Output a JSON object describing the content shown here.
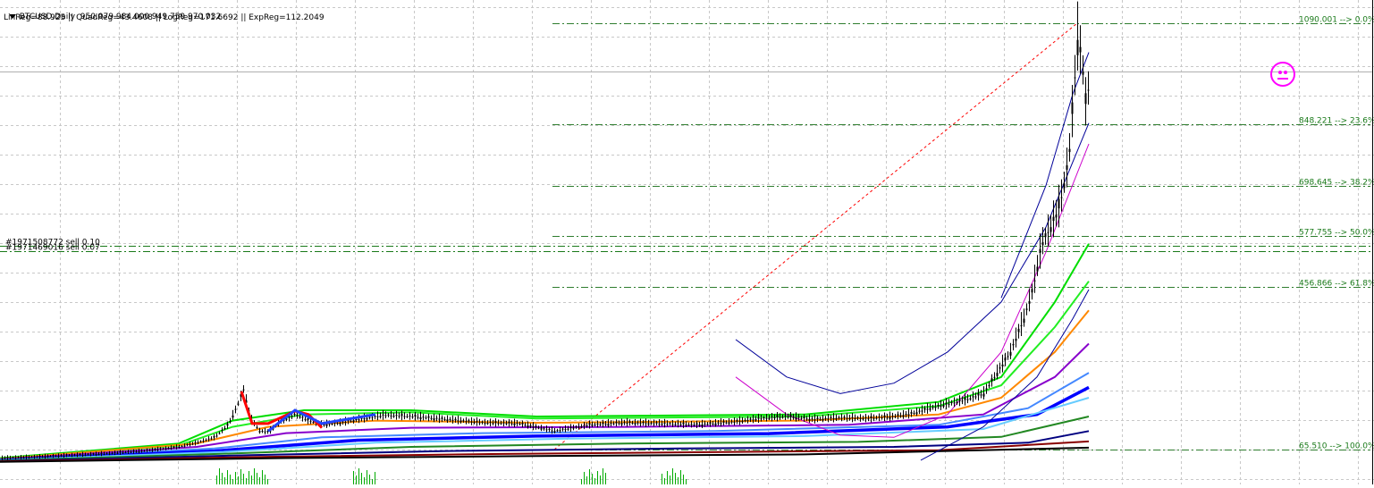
{
  "header": {
    "symbol": "BTCUSD,Daily",
    "ohlc": "950.079 984.000 949.759 970.032",
    "regressions": "LinReg=88.925 || QuadReg=43.4608 || LogReg=171.6692 || ExpReg=112.2049"
  },
  "orders": [
    {
      "label": "#1971508772 sell 0.10",
      "price": 556
    },
    {
      "label": "#1971469016 sell 0.07",
      "price": 543
    }
  ],
  "chart_data": {
    "type": "line",
    "title": "",
    "xlabel": "",
    "ylabel": "",
    "ylim": [
      40,
      1120
    ],
    "grid": true,
    "fib_levels": [
      {
        "label": "1090.001 --> 0.0%",
        "price": 1090.0
      },
      {
        "label": "848.221 --> 23.6%",
        "price": 848.2
      },
      {
        "label": "698.645 --> 38.2%",
        "price": 698.6
      },
      {
        "label": "577.755 --> 50.0%",
        "price": 577.8
      },
      {
        "label": "456.866 --> 61.8%",
        "price": 456.9
      },
      {
        "label": "65.510 --> 100.0%",
        "price": 65.5
      }
    ],
    "price_series": {
      "name": "",
      "x": [
        0,
        40,
        80,
        120,
        160,
        200,
        220,
        240,
        255,
        265,
        272,
        280,
        290,
        300,
        315,
        330,
        345,
        360,
        380,
        400,
        430,
        460,
        500,
        540,
        580,
        620,
        660,
        700,
        740,
        780,
        820,
        850,
        880,
        910,
        940,
        970,
        1000,
        1020,
        1040,
        1060,
        1080,
        1100,
        1115,
        1130,
        1145,
        1155,
        1165,
        1175,
        1185,
        1195,
        1200,
        1205,
        1210,
        1215,
        1218
      ],
      "values": [
        45,
        48,
        52,
        56,
        62,
        72,
        82,
        95,
        125,
        170,
        210,
        140,
        110,
        108,
        135,
        150,
        135,
        125,
        130,
        138,
        148,
        145,
        138,
        130,
        128,
        110,
        125,
        130,
        128,
        125,
        132,
        140,
        145,
        138,
        142,
        140,
        145,
        152,
        165,
        175,
        185,
        200,
        250,
        300,
        380,
        450,
        560,
        600,
        650,
        760,
        900,
        1050,
        1000,
        870,
        960
      ]
    },
    "fib_line": {
      "from": [
        620,
        65.5
      ],
      "to": [
        1205,
        1090
      ]
    },
    "ma_series": [
      {
        "name": "",
        "color": "#00dd00",
        "values": [
          [
            0,
            45
          ],
          [
            200,
            80
          ],
          [
            260,
            135
          ],
          [
            340,
            160
          ],
          [
            460,
            160
          ],
          [
            600,
            145
          ],
          [
            900,
            150
          ],
          [
            1050,
            180
          ],
          [
            1120,
            240
          ],
          [
            1180,
            420
          ],
          [
            1218,
            560
          ]
        ]
      },
      {
        "name": "",
        "color": "#22ee22",
        "values": [
          [
            0,
            44
          ],
          [
            200,
            75
          ],
          [
            260,
            120
          ],
          [
            340,
            150
          ],
          [
            460,
            155
          ],
          [
            600,
            140
          ],
          [
            900,
            145
          ],
          [
            1050,
            170
          ],
          [
            1120,
            220
          ],
          [
            1180,
            360
          ],
          [
            1218,
            470
          ]
        ]
      },
      {
        "name": "",
        "color": "#ff8800",
        "values": [
          [
            0,
            43
          ],
          [
            220,
            80
          ],
          [
            300,
            120
          ],
          [
            420,
            135
          ],
          [
            600,
            130
          ],
          [
            900,
            135
          ],
          [
            1050,
            150
          ],
          [
            1120,
            190
          ],
          [
            1180,
            300
          ],
          [
            1218,
            400
          ]
        ]
      },
      {
        "name": "",
        "color": "#8800cc",
        "values": [
          [
            0,
            42
          ],
          [
            220,
            72
          ],
          [
            320,
            105
          ],
          [
            460,
            118
          ],
          [
            700,
            120
          ],
          [
            950,
            125
          ],
          [
            1100,
            150
          ],
          [
            1180,
            240
          ],
          [
            1218,
            320
          ]
        ]
      },
      {
        "name": "",
        "color": "#4488ff",
        "values": [
          [
            0,
            41
          ],
          [
            240,
            68
          ],
          [
            360,
            95
          ],
          [
            540,
            105
          ],
          [
            800,
            110
          ],
          [
            1050,
            125
          ],
          [
            1150,
            165
          ],
          [
            1218,
            250
          ]
        ]
      },
      {
        "name": "",
        "color": "#0000ff",
        "width": 3.5,
        "values": [
          [
            0,
            40
          ],
          [
            240,
            62
          ],
          [
            400,
            88
          ],
          [
            600,
            98
          ],
          [
            860,
            104
          ],
          [
            1060,
            120
          ],
          [
            1160,
            150
          ],
          [
            1218,
            215
          ]
        ]
      },
      {
        "name": "",
        "color": "#66ccff",
        "values": [
          [
            0,
            40
          ],
          [
            250,
            60
          ],
          [
            420,
            82
          ],
          [
            640,
            92
          ],
          [
            900,
            98
          ],
          [
            1100,
            115
          ],
          [
            1218,
            190
          ]
        ]
      },
      {
        "name": "",
        "color": "#228822",
        "values": [
          [
            0,
            39
          ],
          [
            260,
            56
          ],
          [
            460,
            72
          ],
          [
            700,
            80
          ],
          [
            960,
            84
          ],
          [
            1120,
            96
          ],
          [
            1218,
            145
          ]
        ]
      },
      {
        "name": "",
        "color": "#000080",
        "values": [
          [
            0,
            38
          ],
          [
            280,
            52
          ],
          [
            500,
            62
          ],
          [
            760,
            68
          ],
          [
            1000,
            72
          ],
          [
            1150,
            82
          ],
          [
            1218,
            110
          ]
        ]
      },
      {
        "name": "",
        "color": "#880000",
        "values": [
          [
            0,
            37
          ],
          [
            300,
            48
          ],
          [
            560,
            55
          ],
          [
            820,
            60
          ],
          [
            1050,
            64
          ],
          [
            1218,
            85
          ]
        ]
      },
      {
        "name": "",
        "color": "#000000",
        "values": [
          [
            0,
            36
          ],
          [
            320,
            45
          ],
          [
            600,
            50
          ],
          [
            900,
            54
          ],
          [
            1218,
            70
          ]
        ]
      }
    ],
    "zigzag_red": [
      [
        270,
        205
      ],
      [
        282,
        128
      ],
      [
        300,
        128
      ],
      [
        330,
        158
      ],
      [
        345,
        150
      ],
      [
        360,
        118
      ]
    ],
    "zigzag_blue": [
      [
        300,
        110
      ],
      [
        315,
        135
      ],
      [
        330,
        160
      ],
      [
        360,
        128
      ],
      [
        420,
        150
      ]
    ],
    "regression_curves": [
      {
        "name": "",
        "color": "#000099",
        "values": [
          [
            823,
            330
          ],
          [
            880,
            240
          ],
          [
            940,
            200
          ],
          [
            1000,
            225
          ],
          [
            1060,
            300
          ],
          [
            1120,
            420
          ],
          [
            1170,
            600
          ],
          [
            1218,
            850
          ]
        ]
      },
      {
        "name": "",
        "color": "#000099",
        "values": [
          [
            1030,
            40
          ],
          [
            1100,
            120
          ],
          [
            1160,
            240
          ],
          [
            1200,
            380
          ],
          [
            1218,
            450
          ]
        ]
      },
      {
        "name": "",
        "color": "#000099",
        "values": [
          [
            1120,
            430
          ],
          [
            1170,
            700
          ],
          [
            1200,
            920
          ],
          [
            1218,
            1020
          ]
        ]
      },
      {
        "name": "",
        "color": "#cc00cc",
        "values": [
          [
            823,
            240
          ],
          [
            880,
            150
          ],
          [
            940,
            100
          ],
          [
            1000,
            95
          ],
          [
            1060,
            150
          ],
          [
            1120,
            300
          ],
          [
            1170,
            540
          ],
          [
            1218,
            800
          ]
        ]
      }
    ]
  }
}
